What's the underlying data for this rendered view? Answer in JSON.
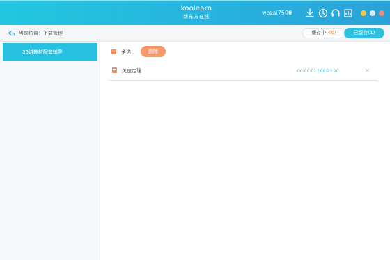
{
  "titlebar": {
    "logo_top": "koolearn",
    "logo_bottom": "新东方在线",
    "username": "wozai7506",
    "icons": [
      "download-icon",
      "history-icon",
      "support-icon",
      "settings-icon"
    ],
    "window_buttons": [
      "#f6c342",
      "#e4e8ee",
      "#f08a7a"
    ]
  },
  "breadcrumb": {
    "text": "当前位置：下载管理"
  },
  "tabs": {
    "downloading_label": "缓存中",
    "downloading_count": "(40)",
    "downloaded_label": "已缓存(1)"
  },
  "sidebar": {
    "items": [
      {
        "label": "36讲教材配套辅导"
      }
    ]
  },
  "main": {
    "select_all_label": "全选",
    "delete_label": "删除",
    "files": [
      {
        "name": "欠速定理",
        "time": "00:00:01 / 00:23:20"
      }
    ]
  }
}
